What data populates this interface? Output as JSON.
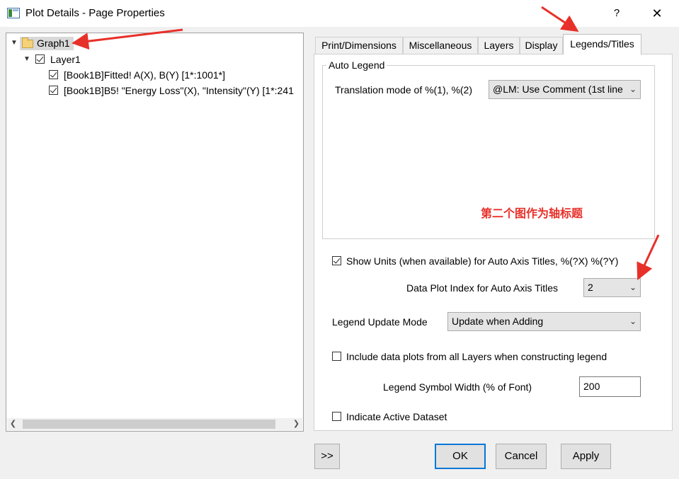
{
  "window": {
    "title": "Plot Details - Page Properties",
    "help_label": "?",
    "close_label": "✕"
  },
  "tree": {
    "graph": "Graph1",
    "layer": "Layer1",
    "plots": [
      "[Book1B]Fitted! A(X), B(Y) [1*:1001*]",
      "[Book1B]B5! \"Energy Loss\"(X), \"Intensity\"(Y) [1*:241"
    ]
  },
  "tabs": [
    "Print/Dimensions",
    "Miscellaneous",
    "Layers",
    "Display",
    "Legends/Titles"
  ],
  "active_tab": "Legends/Titles",
  "auto_legend": {
    "group_title": "Auto Legend",
    "translation_label": "Translation mode of %(1), %(2)",
    "translation_value": "@LM: Use Comment (1st line"
  },
  "annotation": "第二个图作为轴标题",
  "show_units": {
    "checked": true,
    "label": "Show Units (when available) for Auto Axis Titles, %(?X)  %(?Y)"
  },
  "data_plot_index": {
    "label": "Data Plot Index for Auto Axis Titles",
    "value": "2"
  },
  "legend_update": {
    "label": "Legend Update Mode",
    "value": "Update when Adding"
  },
  "include_all_layers": {
    "checked": false,
    "label": "Include data plots from all Layers when constructing legend"
  },
  "symbol_width": {
    "label": "Legend Symbol Width (% of Font)",
    "value": "200"
  },
  "indicate_active": {
    "checked": false,
    "label": "Indicate Active Dataset"
  },
  "buttons": {
    "more": ">>",
    "ok": "OK",
    "cancel": "Cancel",
    "apply": "Apply"
  },
  "colors": {
    "arrow": "#e8302a",
    "accent": "#0078d7"
  }
}
